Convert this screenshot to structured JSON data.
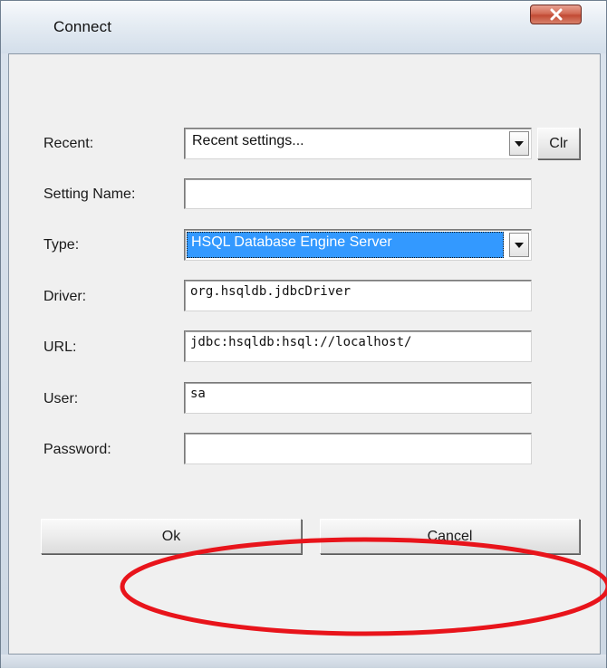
{
  "window": {
    "title": "Connect",
    "close_glyph": "x"
  },
  "form": {
    "recent": {
      "label": "Recent:",
      "value": "Recent settings...",
      "clear_label": "Clr"
    },
    "setting_name": {
      "label": "Setting Name:",
      "value": ""
    },
    "type": {
      "label": "Type:",
      "value": "HSQL Database Engine Server"
    },
    "driver": {
      "label": "Driver:",
      "value": "org.hsqldb.jdbcDriver"
    },
    "url": {
      "label": "URL:",
      "value": "jdbc:hsqldb:hsql://localhost/"
    },
    "user": {
      "label": "User:",
      "value": "sa"
    },
    "password": {
      "label": "Password:",
      "value": ""
    }
  },
  "buttons": {
    "ok": "Ok",
    "cancel": "Cancel"
  },
  "annotation": {
    "shape": "ellipse",
    "color": "#e8141b"
  },
  "icons": {
    "close": "close-icon",
    "combo_arrow": "chevron-down-icon"
  }
}
